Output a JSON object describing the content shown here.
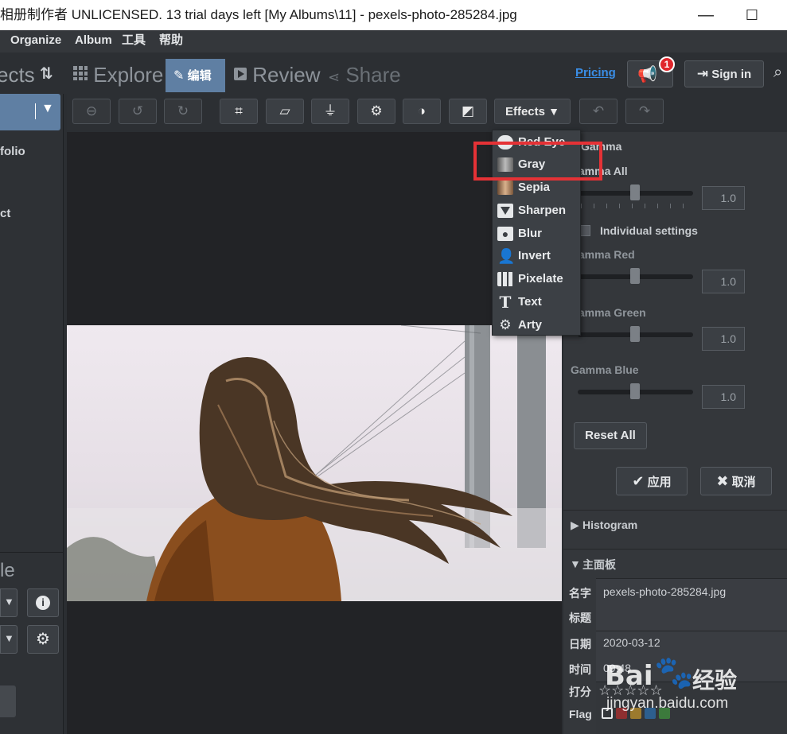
{
  "window": {
    "title": "相册制作者 UNLICENSED. 13 trial days left [My Albums\\11] - pexels-photo-285284.jpg",
    "minimize": "—",
    "maximize": "☐"
  },
  "menu": [
    "Organize",
    "Album",
    "工具",
    "帮助"
  ],
  "left_sidebar": {
    "header_partial": "ects",
    "items_partial": [
      "folio",
      "ct",
      "le"
    ]
  },
  "tabs": {
    "explore": "Explore",
    "edit": "编辑",
    "review": "Review",
    "share": "Share"
  },
  "header_right": {
    "pricing": "Pricing",
    "notification_count": "1",
    "sign_in": "Sign in"
  },
  "toolbar": {
    "effects_label": "Effects"
  },
  "effects_menu": {
    "items": [
      "Red Eye",
      "Gray",
      "Sepia",
      "Sharpen",
      "Blur",
      "Invert",
      "Pixelate",
      "Text",
      "Arty"
    ],
    "highlighted": "Gray"
  },
  "gamma_panel": {
    "title": "Gamma",
    "gamma_all_label": "Gamma All",
    "gamma_all_value": "1.0",
    "individual_label": "Individual settings",
    "individual_checked": false,
    "red_label": "Gamma Red",
    "red_value": "1.0",
    "green_label": "Gamma Green",
    "green_value": "1.0",
    "blue_label": "Gamma Blue",
    "blue_value": "1.0",
    "reset_all": "Reset All",
    "apply": "应用",
    "cancel": "取消"
  },
  "histogram": {
    "label": "Histogram"
  },
  "main_panel": {
    "title": "主面板",
    "rows": [
      {
        "key": "名字",
        "value": "pexels-photo-285284.jpg"
      },
      {
        "key": "标题",
        "value": ""
      },
      {
        "key": "日期",
        "value": "2020-03-12"
      },
      {
        "key": "时间",
        "value": "09:48"
      },
      {
        "key": "打分",
        "value": "☆☆☆☆☆"
      },
      {
        "key": "Flag",
        "value": ""
      }
    ]
  },
  "watermark": {
    "brand": "Bai",
    "brand_suffix": "经验",
    "url": "jingyan.baidu.com"
  },
  "colors": {
    "accent_tab": "#5f7fa3",
    "highlight_box": "#e53236",
    "pricing_link": "#3a8ee6",
    "badge": "#e0262c"
  }
}
